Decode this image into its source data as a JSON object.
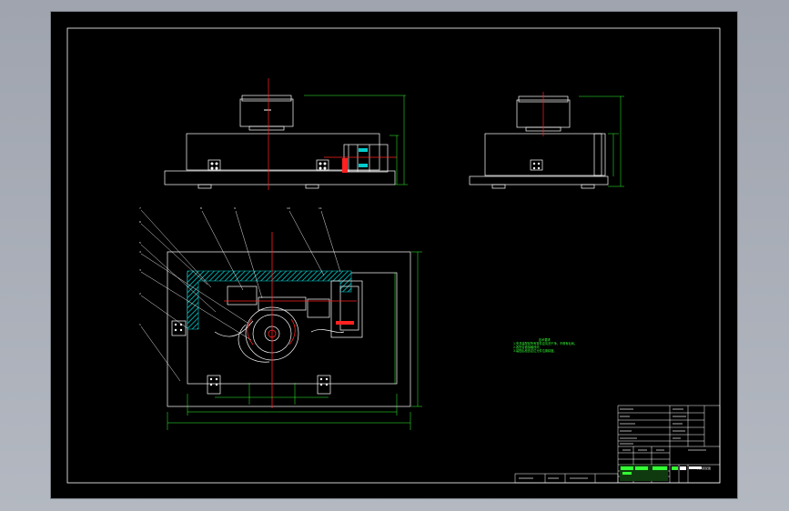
{
  "title": "",
  "colors": {
    "background": "#000000",
    "outline": "#ffffff",
    "dimension": "#33ff33",
    "centerline": "#ff2020",
    "hatch": "#00cccc",
    "viewport": "#a4a9b3"
  },
  "drawing": {
    "views": [
      "front-view",
      "side-view",
      "top-view-section"
    ],
    "part_balloons": [
      "7",
      "8",
      "9",
      "10",
      "11",
      "6",
      "5",
      "4",
      "3",
      "2",
      "1"
    ],
    "tech_notes_heading": "技术要求",
    "tech_notes": [
      "1.夹具装配前所有零件应清洗干净，不得有毛刺。",
      "2.各配合面接触良好。",
      "3.装配后检查定位元件位置精度。"
    ],
    "title_block_caption": "夹具装配图"
  }
}
